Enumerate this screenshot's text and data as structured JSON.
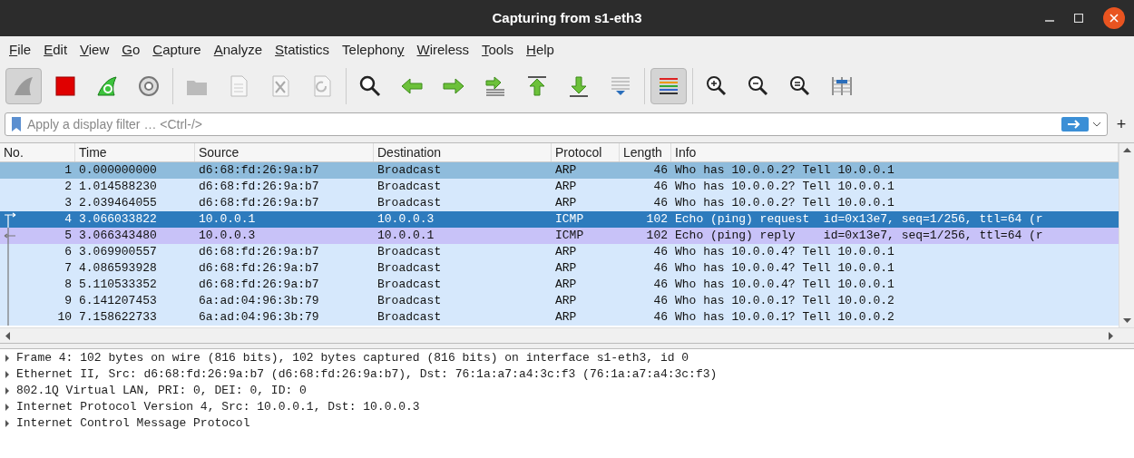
{
  "window": {
    "title": "Capturing from s1-eth3"
  },
  "menu": [
    {
      "key": "F",
      "post": "ile"
    },
    {
      "key": "E",
      "post": "dit"
    },
    {
      "key": "V",
      "post": "iew"
    },
    {
      "key": "G",
      "post": "o"
    },
    {
      "key": "C",
      "post": "apture"
    },
    {
      "key": "A",
      "post": "nalyze"
    },
    {
      "key": "S",
      "post": "tatistics"
    },
    {
      "pre": "Telephon",
      "key": "y"
    },
    {
      "key": "W",
      "post": "ireless"
    },
    {
      "key": "T",
      "post": "ools"
    },
    {
      "key": "H",
      "post": "elp"
    }
  ],
  "toolbar": [
    [
      {
        "pressed": true,
        "disabled": false
      },
      {
        "pressed": false,
        "disabled": false
      },
      {
        "pressed": false,
        "disabled": false
      },
      {
        "pressed": false,
        "disabled": false
      }
    ],
    [
      {
        "pressed": false,
        "disabled": true
      },
      {
        "pressed": false,
        "disabled": true
      },
      {
        "pressed": false,
        "disabled": true
      },
      {
        "pressed": false,
        "disabled": true
      }
    ],
    [
      {
        "pressed": false,
        "disabled": false
      },
      {
        "pressed": false,
        "disabled": false
      },
      {
        "pressed": false,
        "disabled": false
      },
      {
        "pressed": false,
        "disabled": false
      },
      {
        "pressed": false,
        "disabled": false
      },
      {
        "pressed": false,
        "disabled": false
      },
      {
        "pressed": false,
        "disabled": false
      }
    ],
    [
      {
        "pressed": true,
        "disabled": false
      }
    ],
    [
      {
        "pressed": false,
        "disabled": false
      },
      {
        "pressed": false,
        "disabled": false
      },
      {
        "pressed": false,
        "disabled": false
      },
      {
        "pressed": false,
        "disabled": false
      }
    ]
  ],
  "filter": {
    "placeholder": "Apply a display filter … <Ctrl-/>",
    "add_button": "+"
  },
  "table": {
    "columns": [
      "No.",
      "Time",
      "Source",
      "Destination",
      "Protocol",
      "Length",
      "Info"
    ],
    "rows": [
      {
        "cells": [
          "1",
          "0.000000000",
          "d6:68:fd:26:9a:b7",
          "Broadcast",
          "ARP",
          "46",
          "Who has 10.0.0.2? Tell 10.0.0.1"
        ],
        "selected": false,
        "color": "#8fbcdc",
        "kind": "plain"
      },
      {
        "cells": [
          "2",
          "1.014588230",
          "d6:68:fd:26:9a:b7",
          "Broadcast",
          "ARP",
          "46",
          "Who has 10.0.0.2? Tell 10.0.0.1"
        ],
        "selected": false,
        "color": "#d6e8fc",
        "kind": "plain"
      },
      {
        "cells": [
          "3",
          "2.039464055",
          "d6:68:fd:26:9a:b7",
          "Broadcast",
          "ARP",
          "46",
          "Who has 10.0.0.2? Tell 10.0.0.1"
        ],
        "selected": false,
        "color": "#d6e8fc",
        "kind": "plain"
      },
      {
        "cells": [
          "4",
          "3.066033822",
          "10.0.0.1",
          "10.0.0.3",
          "ICMP",
          "102",
          "Echo (ping) request  id=0x13e7, seq=1/256, ttl=64 (r"
        ],
        "selected": true,
        "color": "#2d7bbd",
        "kind": "request"
      },
      {
        "cells": [
          "5",
          "3.066343480",
          "10.0.0.3",
          "10.0.0.1",
          "ICMP",
          "102",
          "Echo (ping) reply    id=0x13e7, seq=1/256, ttl=64 (r"
        ],
        "selected": false,
        "color": "#c8c2f8",
        "kind": "reply"
      },
      {
        "cells": [
          "6",
          "3.069900557",
          "d6:68:fd:26:9a:b7",
          "Broadcast",
          "ARP",
          "46",
          "Who has 10.0.0.4? Tell 10.0.0.1"
        ],
        "selected": false,
        "color": "#d6e8fc",
        "kind": "spanned"
      },
      {
        "cells": [
          "7",
          "4.086593928",
          "d6:68:fd:26:9a:b7",
          "Broadcast",
          "ARP",
          "46",
          "Who has 10.0.0.4? Tell 10.0.0.1"
        ],
        "selected": false,
        "color": "#d6e8fc",
        "kind": "spanned"
      },
      {
        "cells": [
          "8",
          "5.110533352",
          "d6:68:fd:26:9a:b7",
          "Broadcast",
          "ARP",
          "46",
          "Who has 10.0.0.4? Tell 10.0.0.1"
        ],
        "selected": false,
        "color": "#d6e8fc",
        "kind": "spanned"
      },
      {
        "cells": [
          "9",
          "6.141207453",
          "6a:ad:04:96:3b:79",
          "Broadcast",
          "ARP",
          "46",
          "Who has 10.0.0.1? Tell 10.0.0.2"
        ],
        "selected": false,
        "color": "#d6e8fc",
        "kind": "spanned"
      },
      {
        "cells": [
          "10",
          "7.158622733",
          "6a:ad:04:96:3b:79",
          "Broadcast",
          "ARP",
          "46",
          "Who has 10.0.0.1? Tell 10.0.0.2"
        ],
        "selected": false,
        "color": "#d6e8fc",
        "kind": "spanned"
      }
    ]
  },
  "details": [
    {
      "text": "Frame 4: 102 bytes on wire (816 bits), 102 bytes captured (816 bits) on interface s1-eth3, id 0",
      "expanded": false
    },
    {
      "text": "Ethernet II, Src: d6:68:fd:26:9a:b7 (d6:68:fd:26:9a:b7), Dst: 76:1a:a7:a4:3c:f3 (76:1a:a7:a4:3c:f3)",
      "expanded": false
    },
    {
      "text": "802.1Q Virtual LAN, PRI: 0, DEI: 0, ID: 0",
      "expanded": false
    },
    {
      "text": "Internet Protocol Version 4, Src: 10.0.0.1, Dst: 10.0.0.3",
      "expanded": false
    },
    {
      "text": "Internet Control Message Protocol",
      "expanded": false
    }
  ]
}
